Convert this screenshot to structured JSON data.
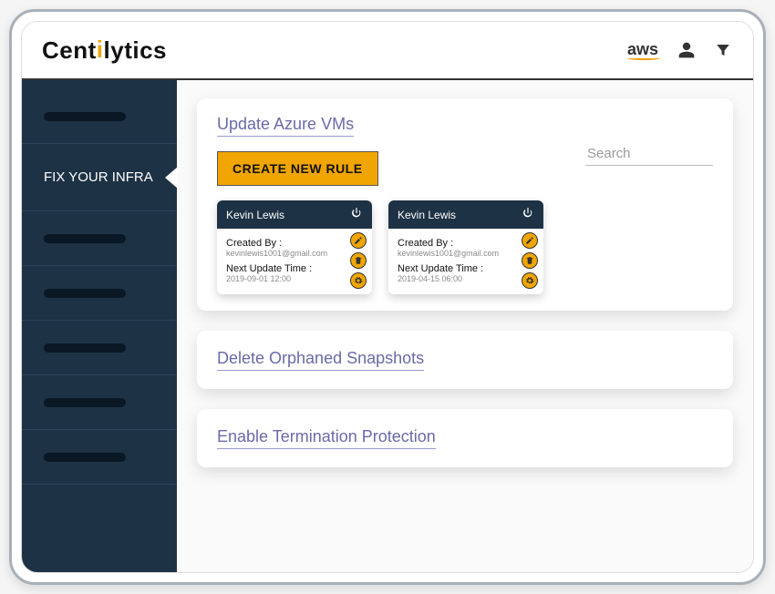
{
  "logo_text_left": "Cent",
  "logo_text_accent": "i",
  "logo_text_right": "lytics",
  "aws_label": "aws",
  "sidebar": {
    "active_label": "FIX YOUR INFRA"
  },
  "panels": {
    "update": {
      "title": "Update Azure VMs",
      "create_label": "CREATE NEW RULE",
      "search_placeholder": "Search",
      "cards": [
        {
          "name": "Kevin Lewis",
          "created_by_label": "Created By :",
          "created_by_value": "kevinlewis1001@gmail.com",
          "next_label": "Next Update Time :",
          "next_value": "2019-09-01 12:00"
        },
        {
          "name": "Kevin Lewis",
          "created_by_label": "Created By :",
          "created_by_value": "kevinlewis1001@gmail.com",
          "next_label": "Next Update Time :",
          "next_value": "2019-04-15 06:00"
        }
      ]
    },
    "snapshots": {
      "title": "Delete Orphaned Snapshots"
    },
    "termination": {
      "title": "Enable Termination Protection"
    }
  }
}
